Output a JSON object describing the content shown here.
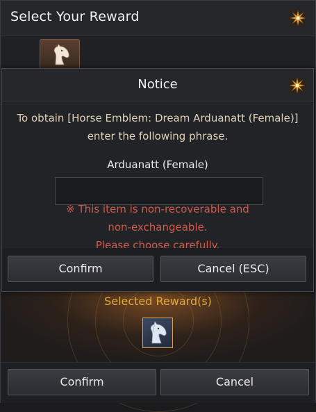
{
  "window": {
    "title": "Select Your Reward"
  },
  "tab": {
    "icon": "horse-head-icon"
  },
  "reward": {
    "selected_label": "Selected Reward(s)",
    "item_icon": "horse-emblem-icon"
  },
  "footer": {
    "confirm_label": "Confirm",
    "cancel_label": "Cancel"
  },
  "modal": {
    "title": "Notice",
    "message_line1": "To obtain [Horse Emblem: Dream Arduanatt (Female)]",
    "message_line2": "enter the following phrase.",
    "phrase": "Arduanatt (Female)",
    "input_value": "",
    "input_placeholder": "",
    "warning_line1": "※ This item is non-recoverable and",
    "warning_line2": "non-exchangeable.",
    "warning_line3": "Please choose carefully.",
    "confirm_label": "Confirm",
    "cancel_label": "Cancel (ESC)"
  },
  "colors": {
    "accent_gold": "#e0a93e",
    "warning_red": "#d05a4a",
    "emblem_orange": "#e8a23a"
  }
}
